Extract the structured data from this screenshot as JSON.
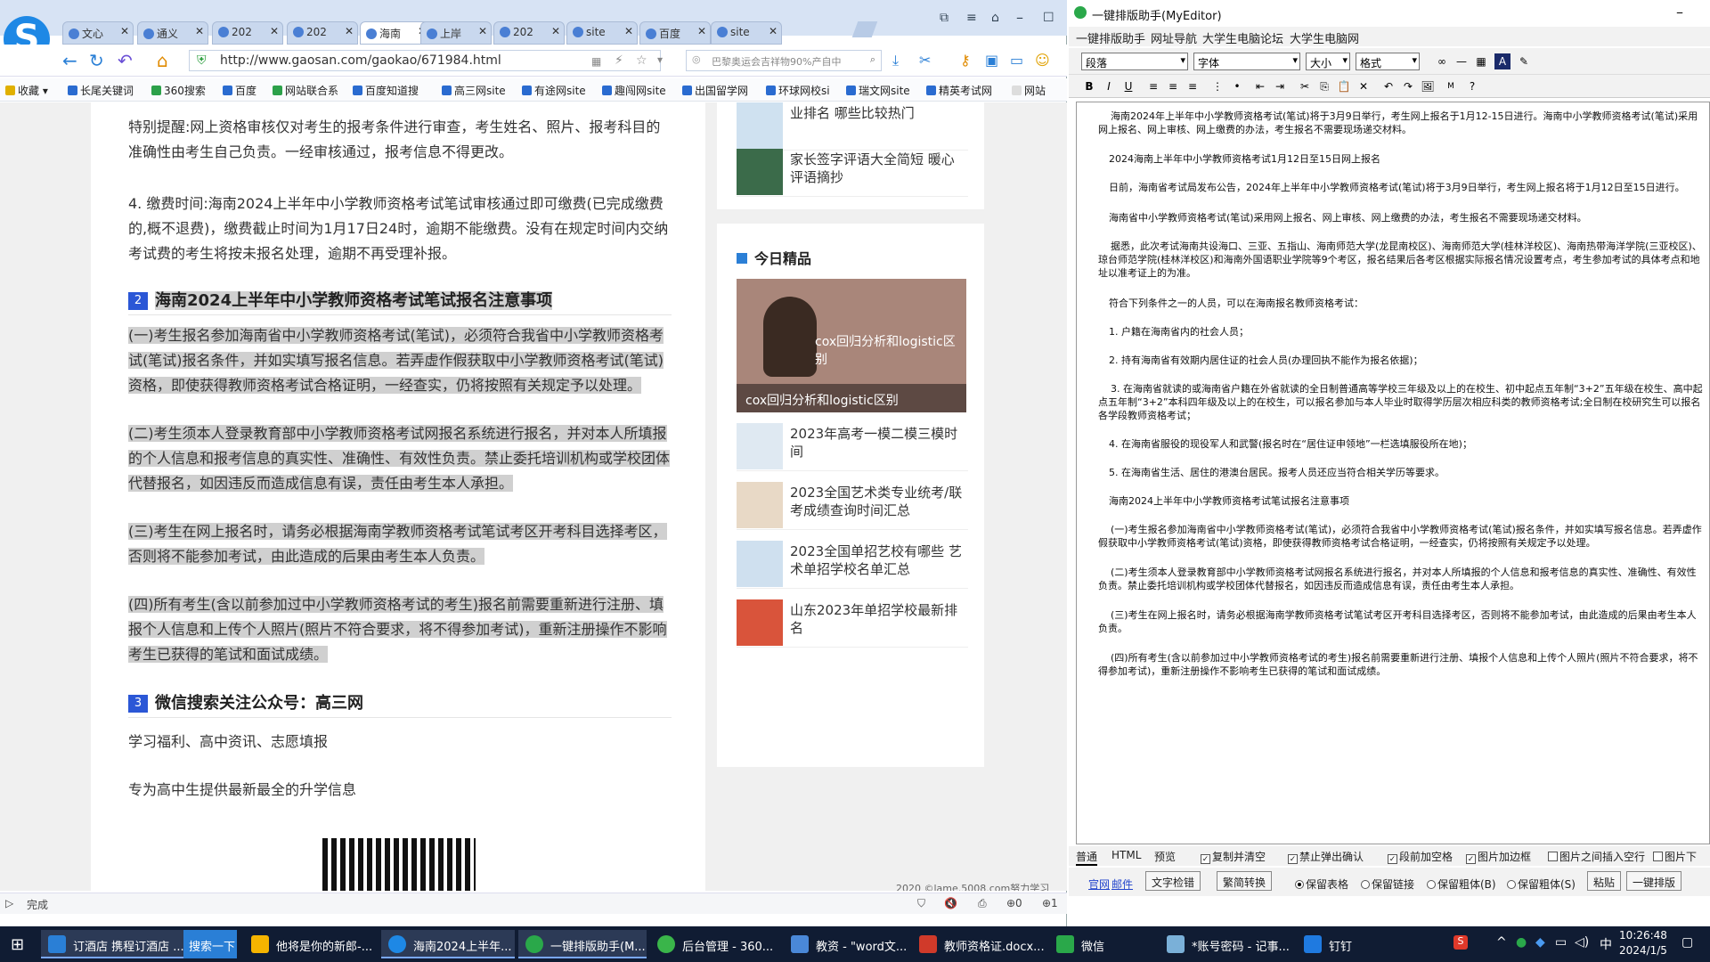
{
  "browser": {
    "tabs": [
      "文心",
      "通义",
      "202",
      "202",
      "海南",
      "上岸",
      "202",
      "site",
      "百度",
      "site"
    ],
    "url": "http://www.gaosan.com/gaokao/671984.html",
    "search_placeholder": "巴黎奥运会吉祥物90%产自中",
    "bookmarks": [
      "收藏",
      "长尾关键词",
      "360搜索",
      "百度",
      "网站联合系",
      "百度知道搜",
      "高三网site",
      "有途网site",
      "趣闯网site",
      "出国留学网",
      "环球网校si",
      "瑞文网site",
      "精英考试网",
      "网站"
    ],
    "article": {
      "p1": "特别提醒:网上资格审核仅对考生的报考条件进行审查，考生姓名、照片、报考科目的准确性由考生自己负责。一经审核通过，报考信息不得更改。",
      "p2": "4. 缴费时间:海南2024上半年中小学教师资格考试笔试审核通过即可缴费(已完成缴费的,概不退费)，缴费截止时间为1月17日24时，逾期不能缴费。没有在规定时间内交纳考试费的考生将按未报名处理，逾期不再受理补报。",
      "h2_num": "2",
      "h2": "海南2024上半年中小学教师资格考试笔试报名注意事项",
      "p3": "(一)考生报名参加海南省中小学教师资格考试(笔试)，必须符合我省中小学教师资格考试(笔试)报名条件，并如实填写报名信息。若弄虚作假获取中小学教师资格考试(笔试)资格，即使获得教师资格考试合格证明，一经查实，仍将按照有关规定予以处理。",
      "p4": "(二)考生须本人登录教育部中小学教师资格考试网报名系统进行报名，并对本人所填报的个人信息和报考信息的真实性、准确性、有效性负责。禁止委托培训机构或学校团体代替报名，如因违反而造成信息有误，责任由考生本人承担。",
      "p5": "(三)考生在网上报名时，请务必根据海南学教师资格考试笔试考区开考科目选择考区，否则将不能参加考试，由此造成的后果由考生本人负责。",
      "p6": "(四)所有考生(含以前参加过中小学教师资格考试的考生)报名前需要重新进行注册、填报个人信息和上传个人照片(照片不符合要求，将不得参加考试)，重新注册操作不影响考生已获得的笔试和面试成绩。",
      "h3_num": "3",
      "h3": "微信搜索关注公众号：高三网",
      "p7": "学习福利、高中资讯、志愿填报",
      "p8": "专为高中生提供最新最全的升学信息"
    },
    "side": {
      "top_items": [
        "业排名 哪些比较热门",
        "家长签字评语大全简短 暖心评语摘抄"
      ],
      "section_title": "今日精品",
      "feature_caption": "cox回归分析和logistic区别",
      "feature_overlay": "cox回归分析和logistic区别",
      "items": [
        "2023年高考一模二模三模时间",
        "2023全国艺术类专业统考/联考成绩查询时间汇总",
        "2023全国单招艺校有哪些 艺术单招学校名单汇总",
        "山东2023年单招学校最新排名"
      ]
    },
    "status": "完成",
    "footer_frag": "2020 ©lame.5008.com努力学习"
  },
  "editor": {
    "title": "一键排版助手(MyEditor)",
    "menu": [
      "一键排版助手",
      "网址导航",
      "大学生电脑论坛",
      "大学生电脑网"
    ],
    "selects": [
      "段落",
      "字体",
      "大小",
      "格式"
    ],
    "doc": [
      "海南2024年上半年中小学教师资格考试(笔试)将于3月9日举行，考生网上报名于1月12-15日进行。海南中小学教师资格考试(笔试)采用网上报名、网上审核、网上缴费的办法，考生报名不需要现场递交材料。",
      "2024海南上半年中小学教师资格考试1月12日至15日网上报名",
      "日前，海南省考试局发布公告，2024年上半年中小学教师资格考试(笔试)将于3月9日举行，考生网上报名将于1月12日至15日进行。",
      "海南省中小学教师资格考试(笔试)采用网上报名、网上审核、网上缴费的办法，考生报名不需要现场递交材料。",
      "据悉，此次考试海南共设海口、三亚、五指山、海南师范大学(龙昆南校区)、海南师范大学(桂林洋校区)、海南热带海洋学院(三亚校区)、琼台师范学院(桂林洋校区)和海南外国语职业学院等9个考区，报名结果后各考区根据实际报名情况设置考点，考生参加考试的具体考点和地址以准考证上的为准。",
      "符合下列条件之一的人员，可以在海南报名教师资格考试：",
      "1. 户籍在海南省内的社会人员；",
      "2. 持有海南省有效期内居住证的社会人员(办理回执不能作为报名依据)；",
      "3. 在海南省就读的或海南省户籍在外省就读的全日制普通高等学校三年级及以上的在校生、初中起点五年制“3+2”五年级在校生、高中起点五年制“3+2”本科四年级及以上的在校生，可以报名参加与本人毕业时取得学历层次相应科类的教师资格考试;全日制在校研究生可以报名各学段教师资格考试；",
      "4. 在海南省服役的现役军人和武警(报名时在“居住证申领地”一栏选填服役所在地)；",
      "5. 在海南省生活、居住的港澳台居民。报考人员还应当符合相关学历等要求。",
      "海南2024上半年中小学教师资格考试笔试报名注意事项",
      "(一)考生报名参加海南省中小学教师资格考试(笔试)，必须符合我省中小学教师资格考试(笔试)报名条件，并如实填写报名信息。若弄虚作假获取中小学教师资格考试(笔试)资格，即使获得教师资格考试合格证明，一经查实，仍将按照有关规定予以处理。",
      "(二)考生须本人登录教育部中小学教师资格考试网报名系统进行报名，并对本人所填报的个人信息和报考信息的真实性、准确性、有效性负责。禁止委托培训机构或学校团体代替报名，如因违反而造成信息有误，责任由考生本人承担。",
      "(三)考生在网上报名时，请务必根据海南学教师资格考试笔试考区开考科目选择考区，否则将不能参加考试，由此造成的后果由考生本人负责。",
      "(四)所有考生(含以前参加过中小学教师资格考试的考生)报名前需要重新进行注册、填报个人信息和上传个人照片(照片不符合要求，将不得参加考试)，重新注册操作不影响考生已获得的笔试和面试成绩。"
    ],
    "view_tabs": [
      "普通",
      "HTML",
      "预览"
    ],
    "checks": [
      "复制并清空",
      "禁止弹出确认",
      "段前加空格",
      "图片加边框",
      "图片之间插入空行",
      "图片下"
    ],
    "links": [
      "官网",
      "邮件"
    ],
    "buttons": [
      "文字检错",
      "繁简转换",
      "粘贴",
      "一键排版"
    ],
    "radios": [
      "保留表格",
      "保留链接",
      "保留粗体(B)",
      "保留粗体(S)"
    ]
  },
  "taskbar": {
    "search_label": "搜索一下",
    "apps": [
      "订酒店 携程订酒店 ...",
      "他将是你的新郎-...",
      "海南2024上半年...",
      "一键排版助手(M...",
      "后台管理 - 360...",
      "教资 - \"word文...",
      "教师资格证.docx...",
      "微信",
      "*账号密码 - 记事...",
      "钉钉"
    ],
    "time": "10:26:48",
    "date": "2024/1/5",
    "ime": "中"
  }
}
